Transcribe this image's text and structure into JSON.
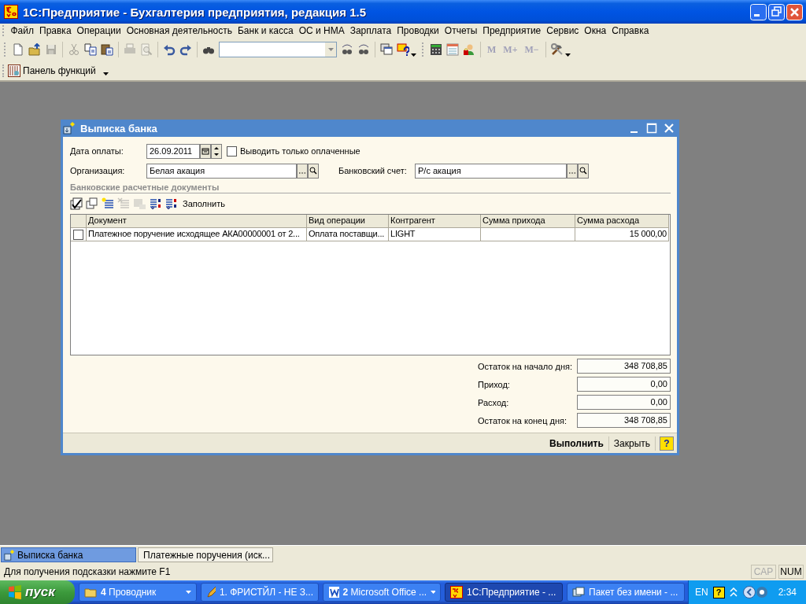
{
  "app_window": {
    "title": "1С:Предприятие - Бухгалтерия предприятия, редакция 1.5"
  },
  "menu": [
    {
      "label": "Файл"
    },
    {
      "label": "Правка"
    },
    {
      "label": "Операции"
    },
    {
      "label": "Основная деятельность"
    },
    {
      "label": "Банк и касса"
    },
    {
      "label": "ОС и НМА"
    },
    {
      "label": "Зарплата"
    },
    {
      "label": "Проводки"
    },
    {
      "label": "Отчеты"
    },
    {
      "label": "Предприятие"
    },
    {
      "label": "Сервис"
    },
    {
      "label": "Окна"
    },
    {
      "label": "Справка"
    }
  ],
  "toolbar": [
    {
      "kind": "new",
      "disabled": false
    },
    {
      "kind": "open",
      "disabled": false
    },
    {
      "kind": "save",
      "disabled": true
    },
    {
      "kind": "separator"
    },
    {
      "kind": "cut",
      "disabled": true
    },
    {
      "kind": "copy",
      "disabled": false
    },
    {
      "kind": "paste",
      "disabled": false
    },
    {
      "kind": "separator"
    },
    {
      "kind": "print",
      "disabled": true
    },
    {
      "kind": "preview",
      "disabled": true
    },
    {
      "kind": "separator"
    },
    {
      "kind": "undo",
      "disabled": false
    },
    {
      "kind": "redo",
      "disabled": false
    },
    {
      "kind": "separator"
    },
    {
      "kind": "find",
      "disabled": false
    },
    {
      "kind": "search_box"
    },
    {
      "kind": "find_prev",
      "disabled": false
    },
    {
      "kind": "find_next",
      "disabled": false
    },
    {
      "kind": "separator"
    },
    {
      "kind": "windows",
      "disabled": false
    },
    {
      "kind": "help_menu",
      "disabled": false
    },
    {
      "kind": "band"
    },
    {
      "kind": "calculator",
      "disabled": false
    },
    {
      "kind": "calendar",
      "disabled": false
    },
    {
      "kind": "user",
      "disabled": false
    },
    {
      "kind": "separator"
    },
    {
      "kind": "memory",
      "label": "M",
      "disabled": true
    },
    {
      "kind": "memory",
      "label": "M+",
      "disabled": true
    },
    {
      "kind": "memory",
      "label": "M−",
      "disabled": true
    },
    {
      "kind": "separator"
    },
    {
      "kind": "tools",
      "disabled": false
    }
  ],
  "function_panel": {
    "label": "Панель функций"
  },
  "document_window": {
    "title": "Выписка банка",
    "payment_date": {
      "label": "Дата оплаты:",
      "value": "26.09.2011"
    },
    "only_paid": {
      "label": "Выводить только оплаченные",
      "checked": false
    },
    "organization": {
      "label": "Организация:",
      "value": "Белая акация"
    },
    "bank_account": {
      "label": "Банковский счет:",
      "value": "Р/с акация"
    },
    "section_title": "Банковские расчетные документы",
    "table_toolbar": [
      {
        "kind": "check_all",
        "disabled": false
      },
      {
        "kind": "copy_rows",
        "disabled": false
      },
      {
        "kind": "add_row",
        "disabled": false
      },
      {
        "kind": "delete_row",
        "disabled": true
      },
      {
        "kind": "post",
        "disabled": true
      },
      {
        "kind": "sort_asc",
        "disabled": false
      },
      {
        "kind": "sort_desc",
        "disabled": false
      },
      {
        "kind": "fill",
        "label": "Заполнить",
        "disabled": false
      }
    ],
    "table": {
      "columns": [
        "Документ",
        "Вид операции",
        "Контрагент",
        "Сумма прихода",
        "Сумма расхода"
      ],
      "rows": [
        {
          "checked": false,
          "document": "Платежное поручение исходящее АКА00000001 от 2...",
          "operation_type": "Оплата поставщи...",
          "counterparty": "LIGHT",
          "expense": "15 000,00"
        }
      ]
    },
    "totals": [
      {
        "label": "Остаток на начало дня:",
        "value": "348 708,85"
      },
      {
        "label": "Приход:",
        "value": "0,00"
      },
      {
        "label": "Расход:",
        "value": "0,00"
      },
      {
        "label": "Остаток на конец дня:",
        "value": "348 708,85"
      }
    ],
    "buttons": [
      {
        "label": "Выполнить",
        "kind": "default"
      },
      {
        "label": "Закрыть",
        "kind": "normal"
      }
    ],
    "help_button": "?"
  },
  "window_tabs": [
    {
      "label": "Выписка банка",
      "selected": true
    },
    {
      "label": "Платежные поручения (иск...",
      "selected": false
    }
  ],
  "status_bar": {
    "hint": "Для получения подсказки нажмите F1",
    "indicators": [
      {
        "label": "CAP",
        "disabled": true
      },
      {
        "label": "NUM",
        "disabled": false
      }
    ]
  },
  "taskbar": {
    "start": "пуск",
    "items": [
      {
        "label": "**4** Проводник",
        "kind": "group",
        "selected": false
      },
      {
        "label": "1. ФРИСТЙЛ - НЕ З...",
        "kind": "single",
        "selected": false
      },
      {
        "label": "**2** Microsoft Office ...",
        "kind": "group",
        "selected": false
      },
      {
        "label": "1С:Предприятие - ...",
        "kind": "single",
        "selected": true
      },
      {
        "label": "Пакет без имени - ...",
        "kind": "single",
        "selected": false
      }
    ],
    "language": "EN",
    "help": "?",
    "time": "2:34"
  }
}
